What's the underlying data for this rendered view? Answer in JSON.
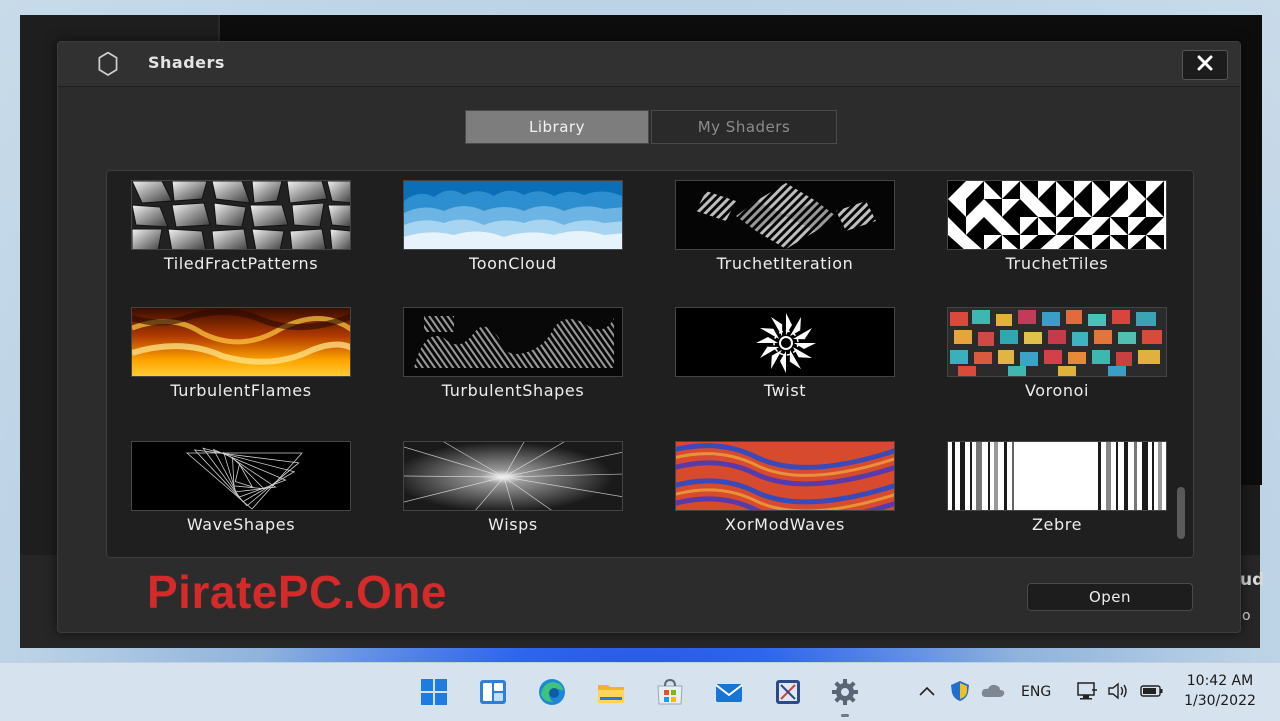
{
  "dialog": {
    "title": "Shaders",
    "close_glyph": "✕",
    "header_icon": "hexagon-icon"
  },
  "tabs": [
    {
      "label": "Library",
      "active": true
    },
    {
      "label": "My Shaders",
      "active": false
    }
  ],
  "shaders": [
    {
      "name": "TiledFractPatterns",
      "thumb": "tiled"
    },
    {
      "name": "ToonCloud",
      "thumb": "cloud"
    },
    {
      "name": "TruchetIteration",
      "thumb": "truchet-iter"
    },
    {
      "name": "TruchetTiles",
      "thumb": "truchet-tiles"
    },
    {
      "name": "TurbulentFlames",
      "thumb": "flames"
    },
    {
      "name": "TurbulentShapes",
      "thumb": "turb-shapes"
    },
    {
      "name": "Twist",
      "thumb": "twist"
    },
    {
      "name": "Voronoi",
      "thumb": "voronoi"
    },
    {
      "name": "WaveShapes",
      "thumb": "waveshapes"
    },
    {
      "name": "Wisps",
      "thumb": "wisps"
    },
    {
      "name": "XorModWaves",
      "thumb": "xormod"
    },
    {
      "name": "Zebre",
      "thumb": "zebre"
    }
  ],
  "actions": {
    "open_label": "Open"
  },
  "watermark": "PiratePC.One",
  "background_app": {
    "partial_text_1": "ud",
    "partial_text_2": "o"
  },
  "taskbar": {
    "apps": [
      "windows-start-icon",
      "widgets-icon",
      "edge-browser-icon",
      "file-explorer-icon",
      "microsoft-store-icon",
      "mail-icon",
      "snipping-tool-icon",
      "settings-gear-icon"
    ],
    "tray": {
      "language": "ENG",
      "time": "10:42 AM",
      "date": "1/30/2022"
    }
  },
  "colors": {
    "watermark": "#d42a2a",
    "dialog_bg": "#2c2c2c",
    "tab_active": "#7d7d7d"
  }
}
